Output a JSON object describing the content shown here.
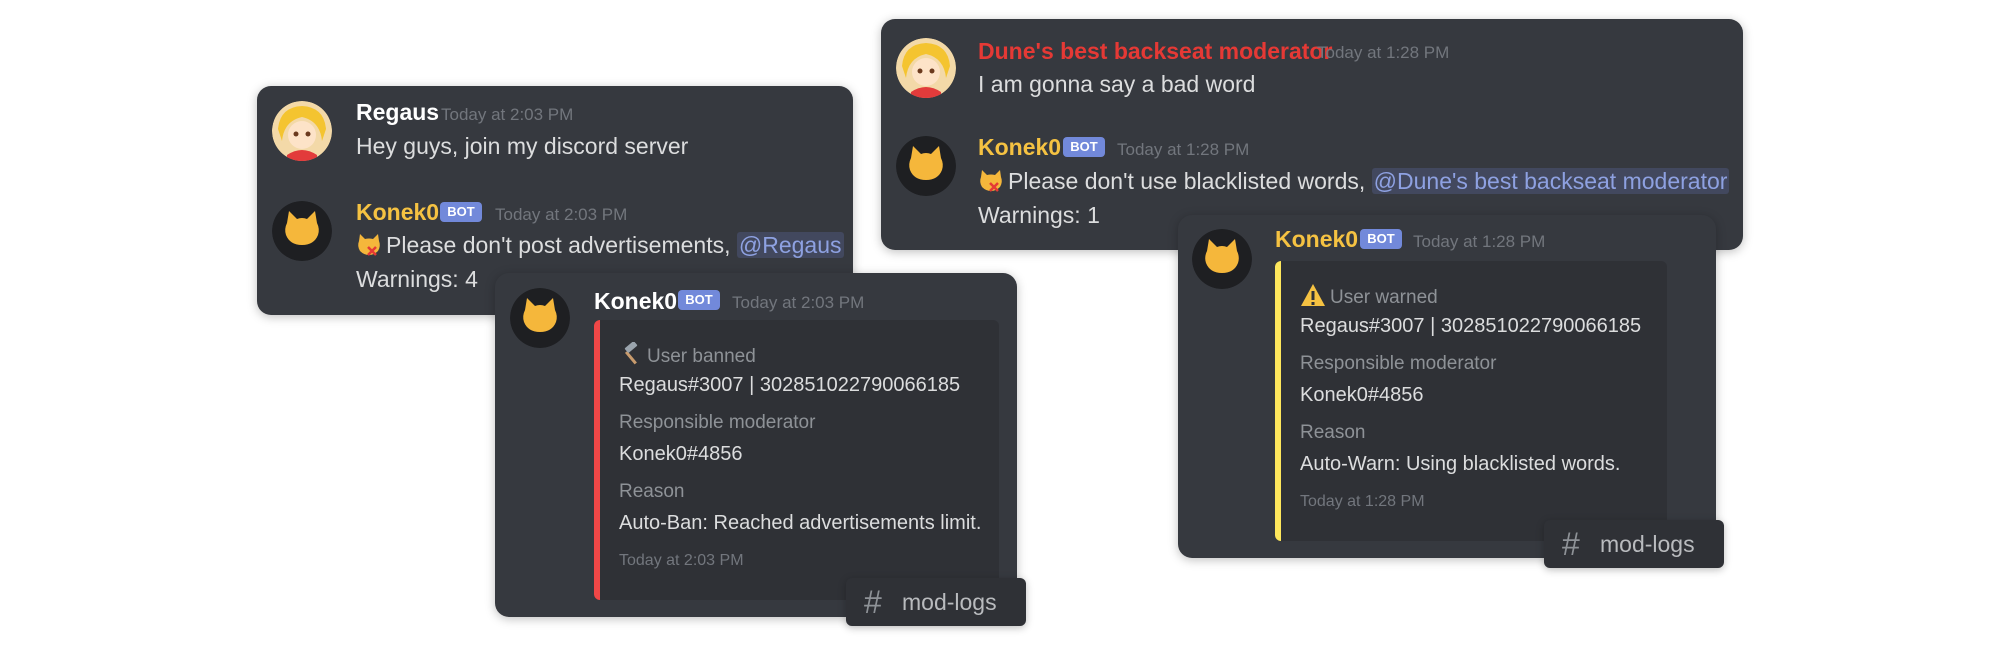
{
  "colors": {
    "card_bg": "#36393f",
    "embed_bg": "#2f3136",
    "ban_bar": "#f04747",
    "warn_bar": "#fee75c",
    "koneko_name": "#f5c242",
    "dune_name": "#e53935",
    "regaus_name": "#ffffff",
    "mention": "#8ea1e1"
  },
  "left": {
    "msg1": {
      "author": "Regaus",
      "time": "Today at 2:03 PM",
      "text": "Hey guys, join my discord server"
    },
    "msg2": {
      "author": "Konek0",
      "bot": "BOT",
      "time": "Today at 2:03 PM",
      "text": "Please don't post advertisements, ",
      "mention": "@Regaus",
      "warnings": "Warnings: 4"
    },
    "embed": {
      "author": "Konek0",
      "bot": "BOT",
      "time": "Today at 2:03 PM",
      "action_icon": "hammer-icon",
      "action": "User banned",
      "user": "Regaus#3007 | 302851022790066185",
      "mod_label": "Responsible moderator",
      "mod": "Konek0#4856",
      "reason_label": "Reason",
      "reason": "Auto-Ban: Reached advertisements limit.",
      "footer": "Today at 2:03 PM"
    },
    "channel": {
      "icon": "hash-icon",
      "name": "mod-logs"
    }
  },
  "right": {
    "msg1": {
      "author": "Dune's best backseat moderator",
      "time": "Today at 1:28 PM",
      "text": "I am gonna say a bad word"
    },
    "msg2": {
      "author": "Konek0",
      "bot": "BOT",
      "time": "Today at 1:28 PM",
      "text": "Please don't use blacklisted words, ",
      "mention": "@Dune's best backseat moderator",
      "warnings": "Warnings: 1"
    },
    "embed": {
      "author": "Konek0",
      "bot": "BOT",
      "time": "Today at 1:28 PM",
      "action_icon": "warning-icon",
      "action": "User warned",
      "user": "Regaus#3007 | 302851022790066185",
      "mod_label": "Responsible moderator",
      "mod": "Konek0#4856",
      "reason_label": "Reason",
      "reason": "Auto-Warn: Using blacklisted words.",
      "footer": "Today at 1:28 PM"
    },
    "channel": {
      "icon": "hash-icon",
      "name": "mod-logs"
    }
  }
}
